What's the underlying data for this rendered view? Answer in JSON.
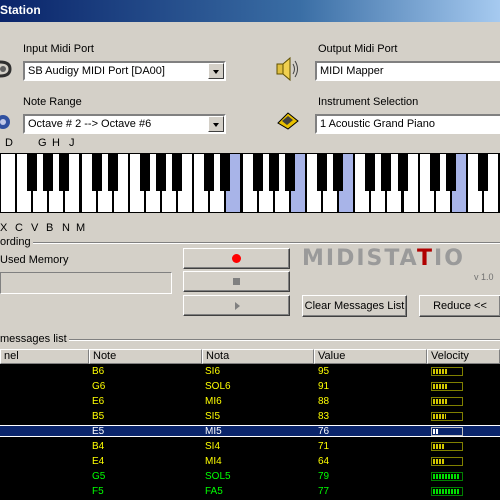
{
  "window": {
    "title": "Station"
  },
  "input_port": {
    "label": "Input Midi Port",
    "value": "SB Audigy MIDI Port [DA00]"
  },
  "output_port": {
    "label": "Output Midi Port",
    "value": "MIDI Mapper"
  },
  "note_range": {
    "label": "Note Range",
    "value": "Octave # 2  --> Octave #6"
  },
  "instrument": {
    "label": "Instrument Selection",
    "value": "1 Acoustic Grand Piano"
  },
  "key_hints_top": [
    "D",
    "G",
    "H",
    "J"
  ],
  "key_hints_bottom": [
    "X",
    "C",
    "V",
    "B",
    "N",
    "M"
  ],
  "recording": {
    "group_label": "ording",
    "used_memory_label": "Used Memory"
  },
  "buttons": {
    "clear": "Clear Messages List",
    "reduce": "Reduce <<"
  },
  "logo": {
    "text_gray": "MIDISTA",
    "text_red": "T",
    "text_gray2": "IO",
    "version": "v 1.0"
  },
  "messages": {
    "group_label": "messages list",
    "columns": [
      "nel",
      "Note",
      "Nota",
      "Value",
      "Velocity"
    ],
    "rows": [
      {
        "note": "B6",
        "nota": "SI6",
        "value": "95",
        "velocity": 0.55,
        "state": ""
      },
      {
        "note": "G6",
        "nota": "SOL6",
        "value": "91",
        "velocity": 0.52,
        "state": ""
      },
      {
        "note": "E6",
        "nota": "MI6",
        "value": "88",
        "velocity": 0.5,
        "state": ""
      },
      {
        "note": "B5",
        "nota": "SI5",
        "value": "83",
        "velocity": 0.47,
        "state": ""
      },
      {
        "note": "E5",
        "nota": "MI5",
        "value": "76",
        "velocity": 0.2,
        "state": "sel"
      },
      {
        "note": "B4",
        "nota": "SI4",
        "value": "71",
        "velocity": 0.4,
        "state": ""
      },
      {
        "note": "E4",
        "nota": "MI4",
        "value": "64",
        "velocity": 0.4,
        "state": ""
      },
      {
        "note": "G5",
        "nota": "SOL5",
        "value": "79",
        "velocity": 0.95,
        "state": "g"
      },
      {
        "note": "F5",
        "nota": "FA5",
        "value": "77",
        "velocity": 0.95,
        "state": "g"
      }
    ]
  },
  "colors": {
    "accent_red": "#b00000",
    "note_yellow": "#ffff00",
    "note_green": "#00ff00",
    "selection": "#0a246a"
  },
  "icons": [
    "midi-in-icon",
    "speaker-icon",
    "note-range-icon",
    "instrument-icon",
    "record-icon",
    "stop-icon",
    "play-icon"
  ]
}
